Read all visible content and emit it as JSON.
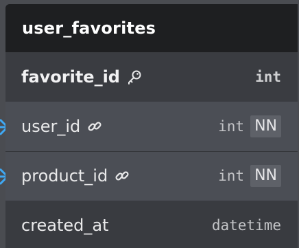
{
  "table": {
    "name": "user_favorites",
    "columns": [
      {
        "name": "favorite_id",
        "type": "int",
        "key": "primary",
        "icon": "key-icon",
        "not_null": ""
      },
      {
        "name": "user_id",
        "type": "int",
        "key": "foreign",
        "icon": "link-icon",
        "not_null": "NN"
      },
      {
        "name": "product_id",
        "type": "int",
        "key": "foreign",
        "icon": "link-icon",
        "not_null": "NN"
      },
      {
        "name": "created_at",
        "type": "datetime",
        "key": "",
        "icon": "",
        "not_null": ""
      }
    ]
  },
  "colors": {
    "header_bg": "#1e1f21",
    "body_bg": "#3d4045",
    "fk_row_bg": "#4b4e55",
    "relation_line": "#3fa9f5"
  }
}
